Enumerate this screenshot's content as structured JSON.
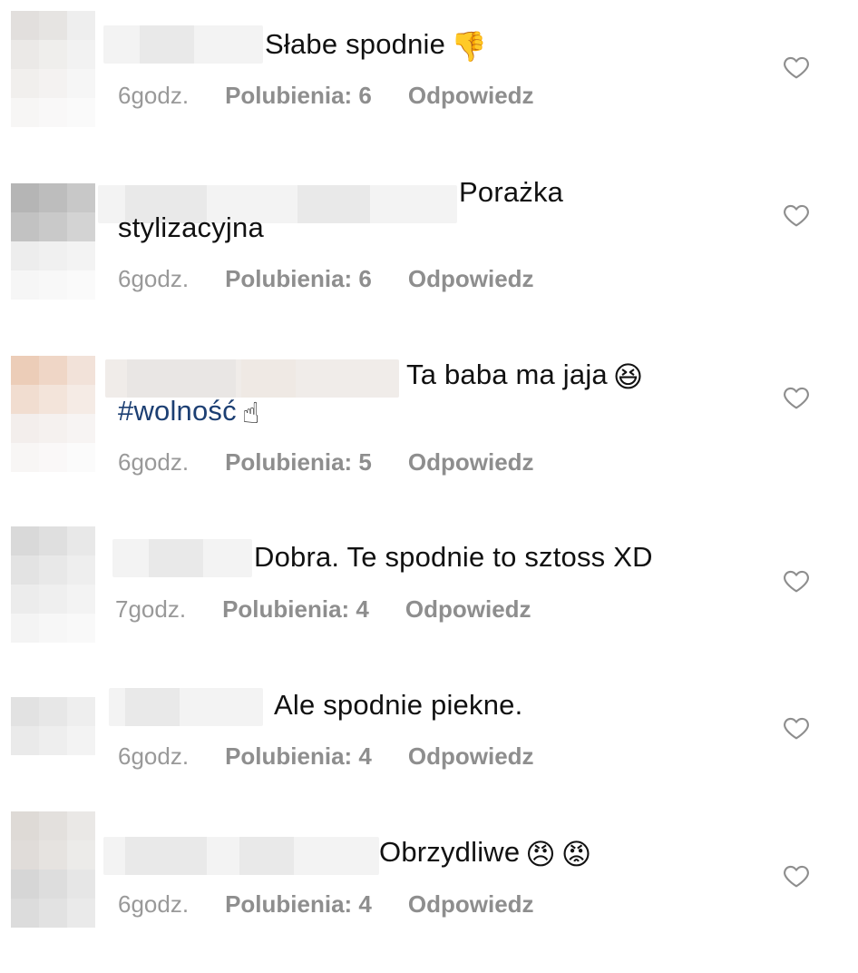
{
  "comments": [
    {
      "text_lead": "Słabe spodnie",
      "text_rest": "",
      "emojis": [
        "👎"
      ],
      "time": "6godz.",
      "likes": "Polubienia: 6",
      "reply": "Odpowiedz"
    },
    {
      "text_lead": "Porażka",
      "text_rest": "stylizacyjna",
      "emojis": [],
      "time": "6godz.",
      "likes": "Polubienia: 6",
      "reply": "Odpowiedz"
    },
    {
      "text_lead": "Ta baba ma jaja",
      "text_rest": "#wolność",
      "emojis": [
        "😆",
        "☝"
      ],
      "time": "6godz.",
      "likes": "Polubienia: 5",
      "reply": "Odpowiedz"
    },
    {
      "text_lead": "Dobra. Te spodnie to sztoss XD",
      "text_rest": "",
      "emojis": [],
      "time": "7godz.",
      "likes": "Polubienia: 4",
      "reply": "Odpowiedz"
    },
    {
      "text_lead": "Ale spodnie piekne.",
      "text_rest": "",
      "emojis": [],
      "time": "6godz.",
      "likes": "Polubienia: 4",
      "reply": "Odpowiedz"
    },
    {
      "text_lead": "Obrzydliwe",
      "text_rest": "",
      "emojis": [
        "😠",
        "😡"
      ],
      "time": "6godz.",
      "likes": "Polubienia: 4",
      "reply": "Odpowiedz"
    }
  ],
  "icons": {
    "like": "heart-outline-icon"
  },
  "colors": {
    "text": "#111111",
    "meta": "#8e8e8e",
    "hashtag": "#1c3f73",
    "heart_stroke": "#8e8e8e"
  }
}
